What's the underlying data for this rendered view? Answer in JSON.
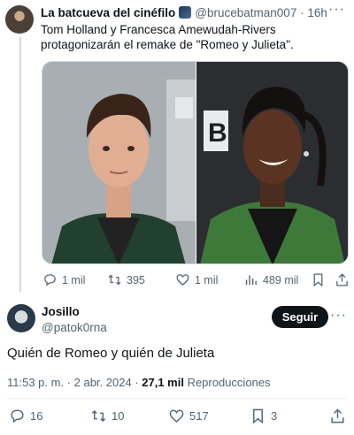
{
  "parent": {
    "display_name": "La batcueva del cinéfilo",
    "handle": "@brucebatman007",
    "separator": "·",
    "time": "16h",
    "more": "···",
    "text": "Tom Holland y Francesca Amewudah-Rivers protagonizarán el remake de \"Romeo y Julieta\".",
    "actions": {
      "replies": "1 mil",
      "retweets": "395",
      "likes": "1 mil",
      "views": "489 mil"
    }
  },
  "reply": {
    "display_name": "Josillo",
    "handle": "@patok0rna",
    "follow_label": "Seguir",
    "more": "···",
    "text": "Quién de Romeo y quién de Julieta",
    "timestamp": "11:53 p. m. · 2 abr. 2024 · ",
    "views_count": "27,1 mil",
    "views_label": " Reproducciones",
    "actions": {
      "replies": "16",
      "retweets": "10",
      "likes": "517",
      "bookmarks": "3"
    }
  },
  "colors": {
    "text": "#0f1419",
    "secondary": "#536471",
    "follow_bg": "#0f1419",
    "border": "#cfd9de"
  }
}
